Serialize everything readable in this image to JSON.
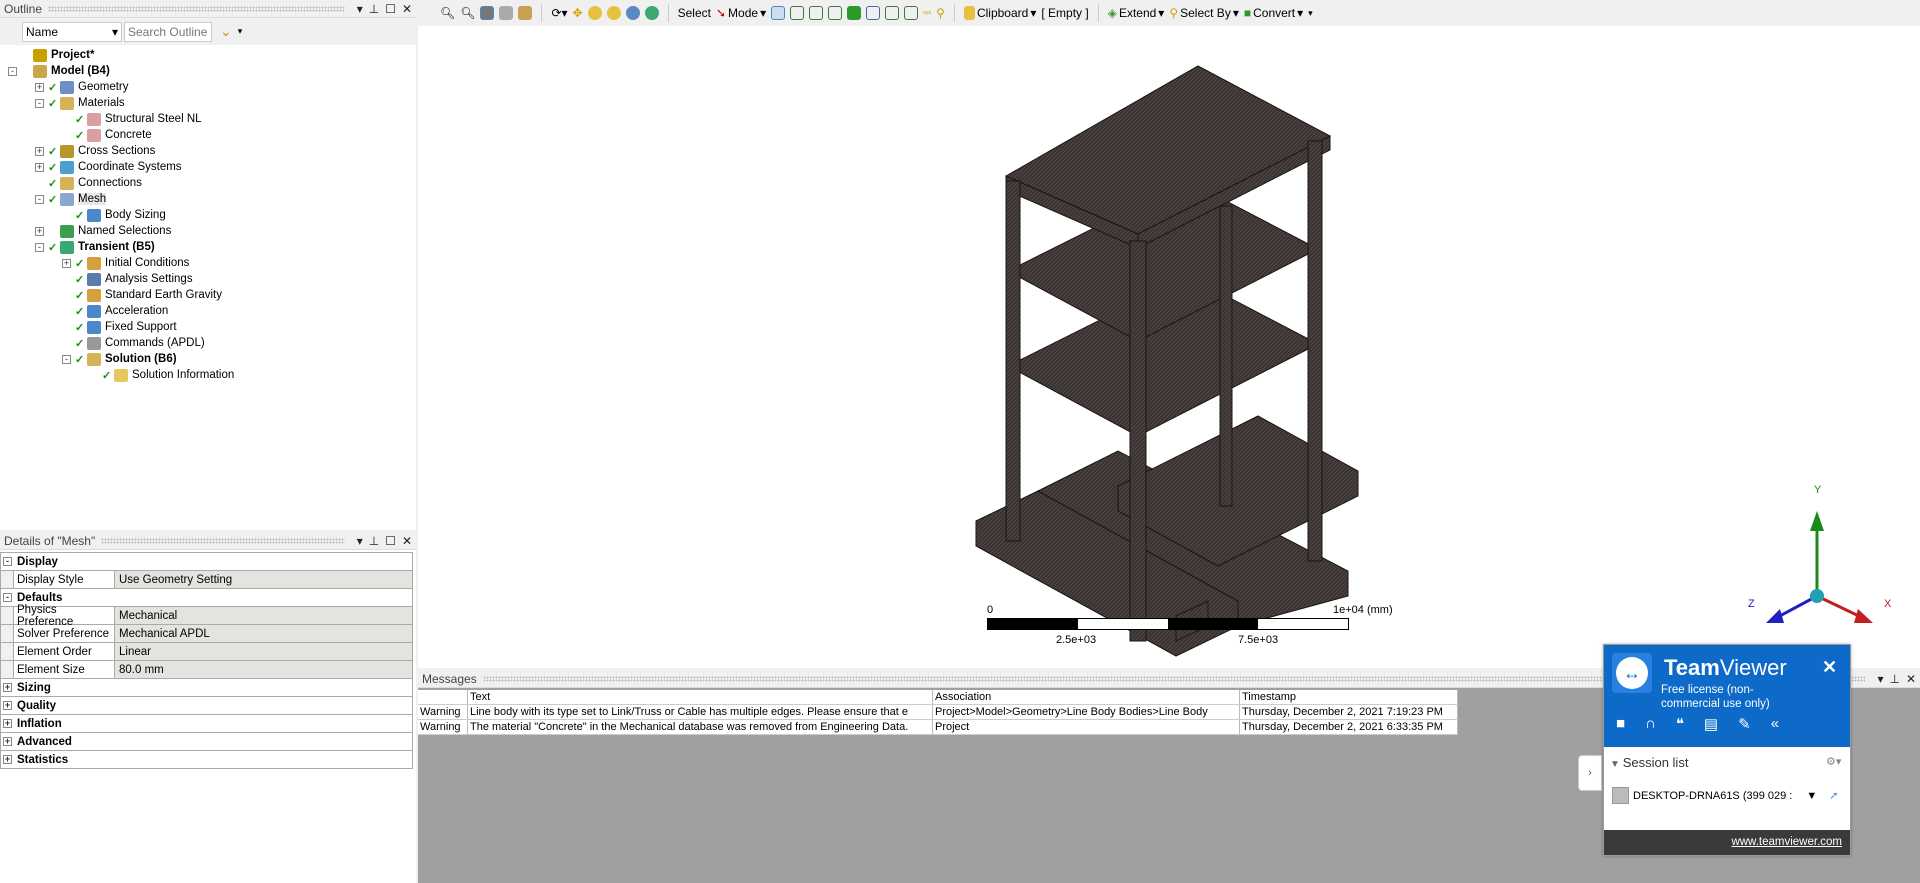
{
  "outline": {
    "title": "Outline",
    "filter_value": "Name",
    "search_placeholder": "Search Outline",
    "items": [
      {
        "label": "Project*",
        "bold": true,
        "depth": 0,
        "tog": "",
        "chk": false,
        "color": "#c8a000"
      },
      {
        "label": "Model (B4)",
        "bold": true,
        "depth": 0,
        "tog": "-",
        "chk": false,
        "color": "#c9a84a"
      },
      {
        "label": "Geometry",
        "depth": 1,
        "tog": "+",
        "chk": true,
        "color": "#6d8fc7"
      },
      {
        "label": "Materials",
        "depth": 1,
        "tog": "-",
        "chk": true,
        "color": "#d6b25a"
      },
      {
        "label": "Structural Steel NL",
        "depth": 2,
        "tog": "",
        "chk": true,
        "color": "#d9a0a0"
      },
      {
        "label": "Concrete",
        "depth": 2,
        "tog": "",
        "chk": true,
        "color": "#d9a0a0"
      },
      {
        "label": "Cross Sections",
        "depth": 1,
        "tog": "+",
        "chk": true,
        "color": "#b8962a"
      },
      {
        "label": "Coordinate Systems",
        "depth": 1,
        "tog": "+",
        "chk": true,
        "color": "#4aa0d0"
      },
      {
        "label": "Connections",
        "depth": 1,
        "tog": "",
        "chk": true,
        "color": "#d6b25a"
      },
      {
        "label": "Mesh",
        "depth": 1,
        "tog": "-",
        "chk": true,
        "color": "#8ba6cf"
      },
      {
        "label": "Body Sizing",
        "depth": 2,
        "tog": "",
        "chk": true,
        "color": "#4a88c7"
      },
      {
        "label": "Named Selections",
        "depth": 1,
        "tog": "+",
        "chk": false,
        "color": "#3aa050"
      },
      {
        "label": "Transient (B5)",
        "bold": true,
        "depth": 1,
        "tog": "-",
        "chk": true,
        "color": "#3aa870"
      },
      {
        "label": "Initial Conditions",
        "depth": 2,
        "tog": "+",
        "chk": true,
        "color": "#d6a040"
      },
      {
        "label": "Analysis Settings",
        "depth": 2,
        "tog": "",
        "chk": true,
        "color": "#5a7ab0"
      },
      {
        "label": "Standard Earth Gravity",
        "depth": 2,
        "tog": "",
        "chk": true,
        "color": "#d6a040"
      },
      {
        "label": "Acceleration",
        "depth": 2,
        "tog": "",
        "chk": true,
        "color": "#4a88c7"
      },
      {
        "label": "Fixed Support",
        "depth": 2,
        "tog": "",
        "chk": true,
        "color": "#4a88c7"
      },
      {
        "label": "Commands (APDL)",
        "depth": 2,
        "tog": "",
        "chk": true,
        "color": "#999999"
      },
      {
        "label": "Solution (B6)",
        "bold": true,
        "depth": 2,
        "tog": "-",
        "chk": true,
        "color": "#d6b25a"
      },
      {
        "label": "Solution Information",
        "depth": 3,
        "tog": "",
        "chk": true,
        "color": "#e6c860"
      }
    ]
  },
  "details": {
    "title": "Details of \"Mesh\"",
    "rows": [
      {
        "type": "grp",
        "tog": "-",
        "label": "Display"
      },
      {
        "type": "prop",
        "label": "Display Style",
        "value": "Use Geometry Setting"
      },
      {
        "type": "grp",
        "tog": "-",
        "label": "Defaults"
      },
      {
        "type": "prop",
        "label": "Physics Preference",
        "value": "Mechanical"
      },
      {
        "type": "prop",
        "label": "Solver Preference",
        "value": "Mechanical APDL"
      },
      {
        "type": "prop",
        "label": "Element Order",
        "value": "Linear"
      },
      {
        "type": "prop",
        "label": "Element Size",
        "value": "80.0 mm"
      },
      {
        "type": "grp",
        "tog": "+",
        "label": "Sizing"
      },
      {
        "type": "grp",
        "tog": "+",
        "label": "Quality"
      },
      {
        "type": "grp",
        "tog": "+",
        "label": "Inflation"
      },
      {
        "type": "grp",
        "tog": "+",
        "label": "Advanced"
      },
      {
        "type": "grp",
        "tog": "+",
        "label": "Statistics"
      }
    ]
  },
  "toolbar": {
    "select": "Select",
    "mode": "Mode",
    "clipboard": "Clipboard",
    "empty": "[ Empty ]",
    "extend": "Extend",
    "select_by": "Select By",
    "convert": "Convert"
  },
  "viewport": {
    "scale": {
      "zero": "0",
      "max": "1e+04 (mm)",
      "q1": "2.5e+03",
      "q3": "7.5e+03"
    },
    "axes": {
      "x": "X",
      "y": "Y",
      "z": "Z"
    }
  },
  "messages": {
    "title": "Messages",
    "columns": [
      "",
      "Text",
      "Association",
      "Timestamp"
    ],
    "rows": [
      [
        "Warning",
        "Line body with its type set to Link/Truss or Cable has multiple edges. Please ensure that e",
        "Project>Model>Geometry>Line Body Bodies>Line Body",
        "Thursday, December 2, 2021 7:19:23 PM"
      ],
      [
        "Warning",
        "The material \"Concrete\" in the Mechanical database was removed from Engineering Data.",
        "Project",
        "Thursday, December 2, 2021 6:33:35 PM"
      ]
    ]
  },
  "teamviewer": {
    "brand_bold": "Team",
    "brand_rest": "Viewer",
    "license": "Free license (non-commercial use only)",
    "session_list": "Session list",
    "session": "DESKTOP-DRNA61S (399 029 :",
    "link": "www.teamviewer.com",
    "accent": "#0e6ac9"
  }
}
